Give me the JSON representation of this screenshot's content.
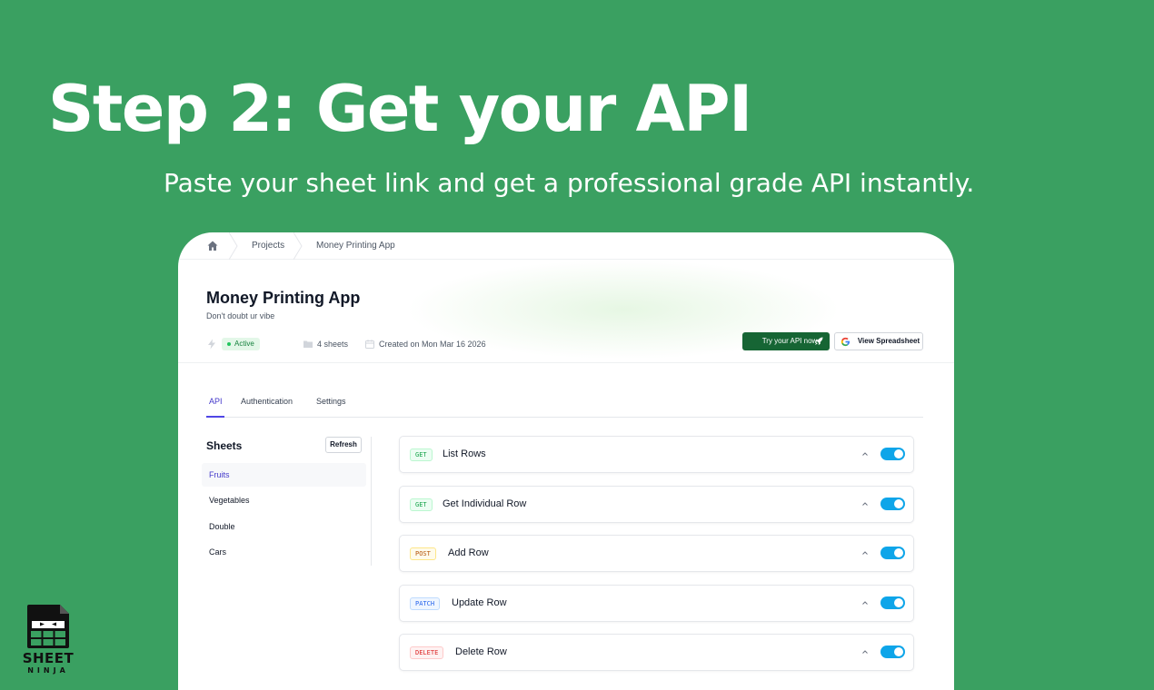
{
  "hero": {
    "title": "Step 2: Get your API",
    "subtitle": "Paste your sheet link and get a professional grade API instantly."
  },
  "breadcrumb": {
    "items": [
      "Projects",
      "Money Printing App"
    ]
  },
  "project": {
    "title": "Money Printing App",
    "subtitle": "Don't doubt ur vibe",
    "status": "Active",
    "sheets_count": "4 sheets",
    "created": "Created on Mon Mar 16 2026"
  },
  "actions": {
    "try_api": "Try your API now",
    "view_spreadsheet": "View Spreadsheet"
  },
  "tabs": [
    {
      "label": "API",
      "active": true
    },
    {
      "label": "Authentication",
      "active": false
    },
    {
      "label": "Settings",
      "active": false
    }
  ],
  "sheets": {
    "heading": "Sheets",
    "refresh_label": "Refresh",
    "items": [
      "Fruits",
      "Vegetables",
      "Double",
      "Cars"
    ],
    "selected": "Fruits"
  },
  "endpoints": [
    {
      "method": "GET",
      "name": "List Rows",
      "enabled": true
    },
    {
      "method": "GET",
      "name": "Get Individual Row",
      "enabled": true
    },
    {
      "method": "POST",
      "name": "Add Row",
      "enabled": true
    },
    {
      "method": "PATCH",
      "name": "Update Row",
      "enabled": true
    },
    {
      "method": "DELETE",
      "name": "Delete Row",
      "enabled": true
    }
  ],
  "colors": {
    "background": "#3aa061",
    "accent": "#4f46e5",
    "primary_button": "#166534",
    "toggle_on": "#0ea5e9",
    "get": "#16a34a",
    "post": "#b45309",
    "patch": "#2563eb",
    "delete": "#dc2626"
  },
  "logo": {
    "line1": "SHEET",
    "line2": "NINJA"
  }
}
